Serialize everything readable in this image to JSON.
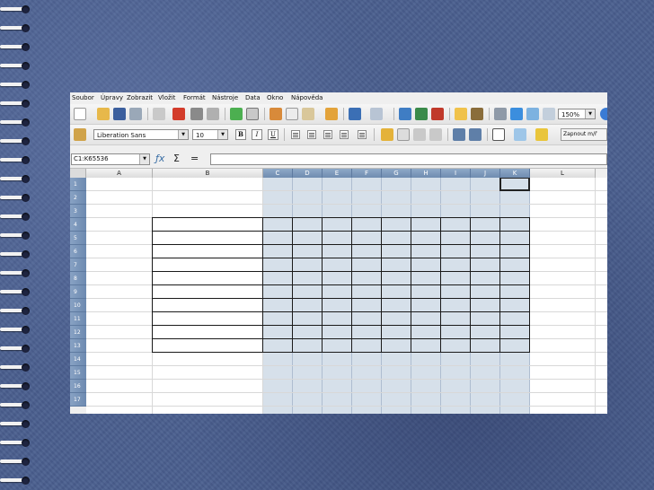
{
  "menu": [
    "Soubor",
    "Úpravy",
    "Zobrazit",
    "Vložit",
    "Formát",
    "Nástroje",
    "Data",
    "Okno",
    "Nápověda"
  ],
  "toolbar": {
    "zoom": "150%",
    "font_name": "Liberation Sans",
    "font_size": "10",
    "bold_label": "B",
    "italic_label": "I",
    "underline_label": "U",
    "wrap_button": "Zapnout m/ř"
  },
  "formula_bar": {
    "name_box": "C1:K65536",
    "formula": ""
  },
  "sheet": {
    "columns": [
      "A",
      "B",
      "C",
      "D",
      "E",
      "F",
      "G",
      "H",
      "I",
      "J",
      "K",
      "L"
    ],
    "rows": [
      "1",
      "2",
      "3",
      "4",
      "5",
      "6",
      "7",
      "8",
      "9",
      "10",
      "11",
      "12",
      "13",
      "14",
      "15",
      "16",
      "17"
    ],
    "selected_columns": [
      "C",
      "D",
      "E",
      "F",
      "G",
      "H",
      "I",
      "J",
      "K"
    ],
    "active_cell": "K1"
  },
  "colors": {
    "selection": "#d6e0ea",
    "selected_header": "#7a96ba",
    "background": "#4a5f8f"
  }
}
